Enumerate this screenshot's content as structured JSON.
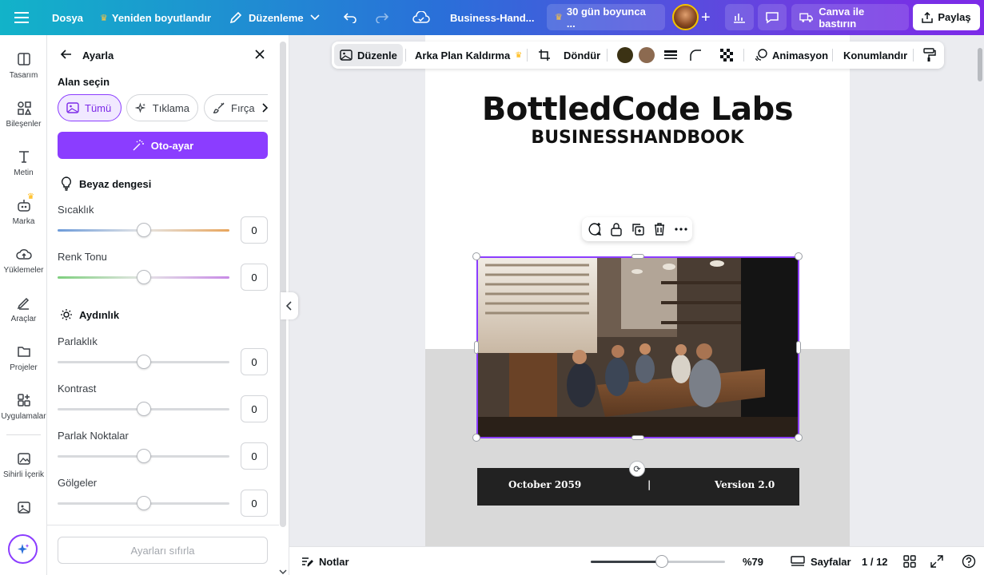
{
  "topbar": {
    "file": "Dosya",
    "resize": "Yeniden boyutlandır",
    "edit_mode": "Düzenleme",
    "doc_name": "Business-Hand...",
    "trial": "30 gün boyunca ...",
    "print": "Canva ile bastırın",
    "share": "Paylaş"
  },
  "rail": {
    "items": [
      "Tasarım",
      "Bileşenler",
      "Metin",
      "Marka",
      "Yüklemeler",
      "Araçlar",
      "Projeler",
      "Uygulamalar",
      "Sihirli İçerik"
    ]
  },
  "panel": {
    "title": "Ayarla",
    "area_label": "Alan seçin",
    "area_options": [
      "Tümü",
      "Tıklama",
      "Fırça"
    ],
    "auto_adjust": "Oto-ayar",
    "white_balance": "Beyaz dengesi",
    "light": "Aydınlık",
    "sliders": [
      {
        "label": "Sıcaklık",
        "value": "0"
      },
      {
        "label": "Renk Tonu",
        "value": "0"
      },
      {
        "label": "Parlaklık",
        "value": "0"
      },
      {
        "label": "Kontrast",
        "value": "0"
      },
      {
        "label": "Parlak Noktalar",
        "value": "0"
      },
      {
        "label": "Gölgeler",
        "value": "0"
      }
    ],
    "reset": "Ayarları sıfırla"
  },
  "context_toolbar": {
    "edit": "Düzenle",
    "bg_remove": "Arka Plan Kaldırma",
    "rotate": "Döndür",
    "colors": [
      "#3b3214",
      "#8c6a50"
    ],
    "animate": "Animasyon",
    "position": "Konumlandır"
  },
  "document": {
    "title": "BottledCode Labs",
    "subtitle": "BUSINESSHANDBOOK",
    "date": "October 2059",
    "separator": "|",
    "version": "Version 2.0"
  },
  "bottombar": {
    "notes": "Notlar",
    "zoom": "%79",
    "zoom_fraction": 0.53,
    "pages": "Sayfalar",
    "page_count": "1 / 12"
  }
}
